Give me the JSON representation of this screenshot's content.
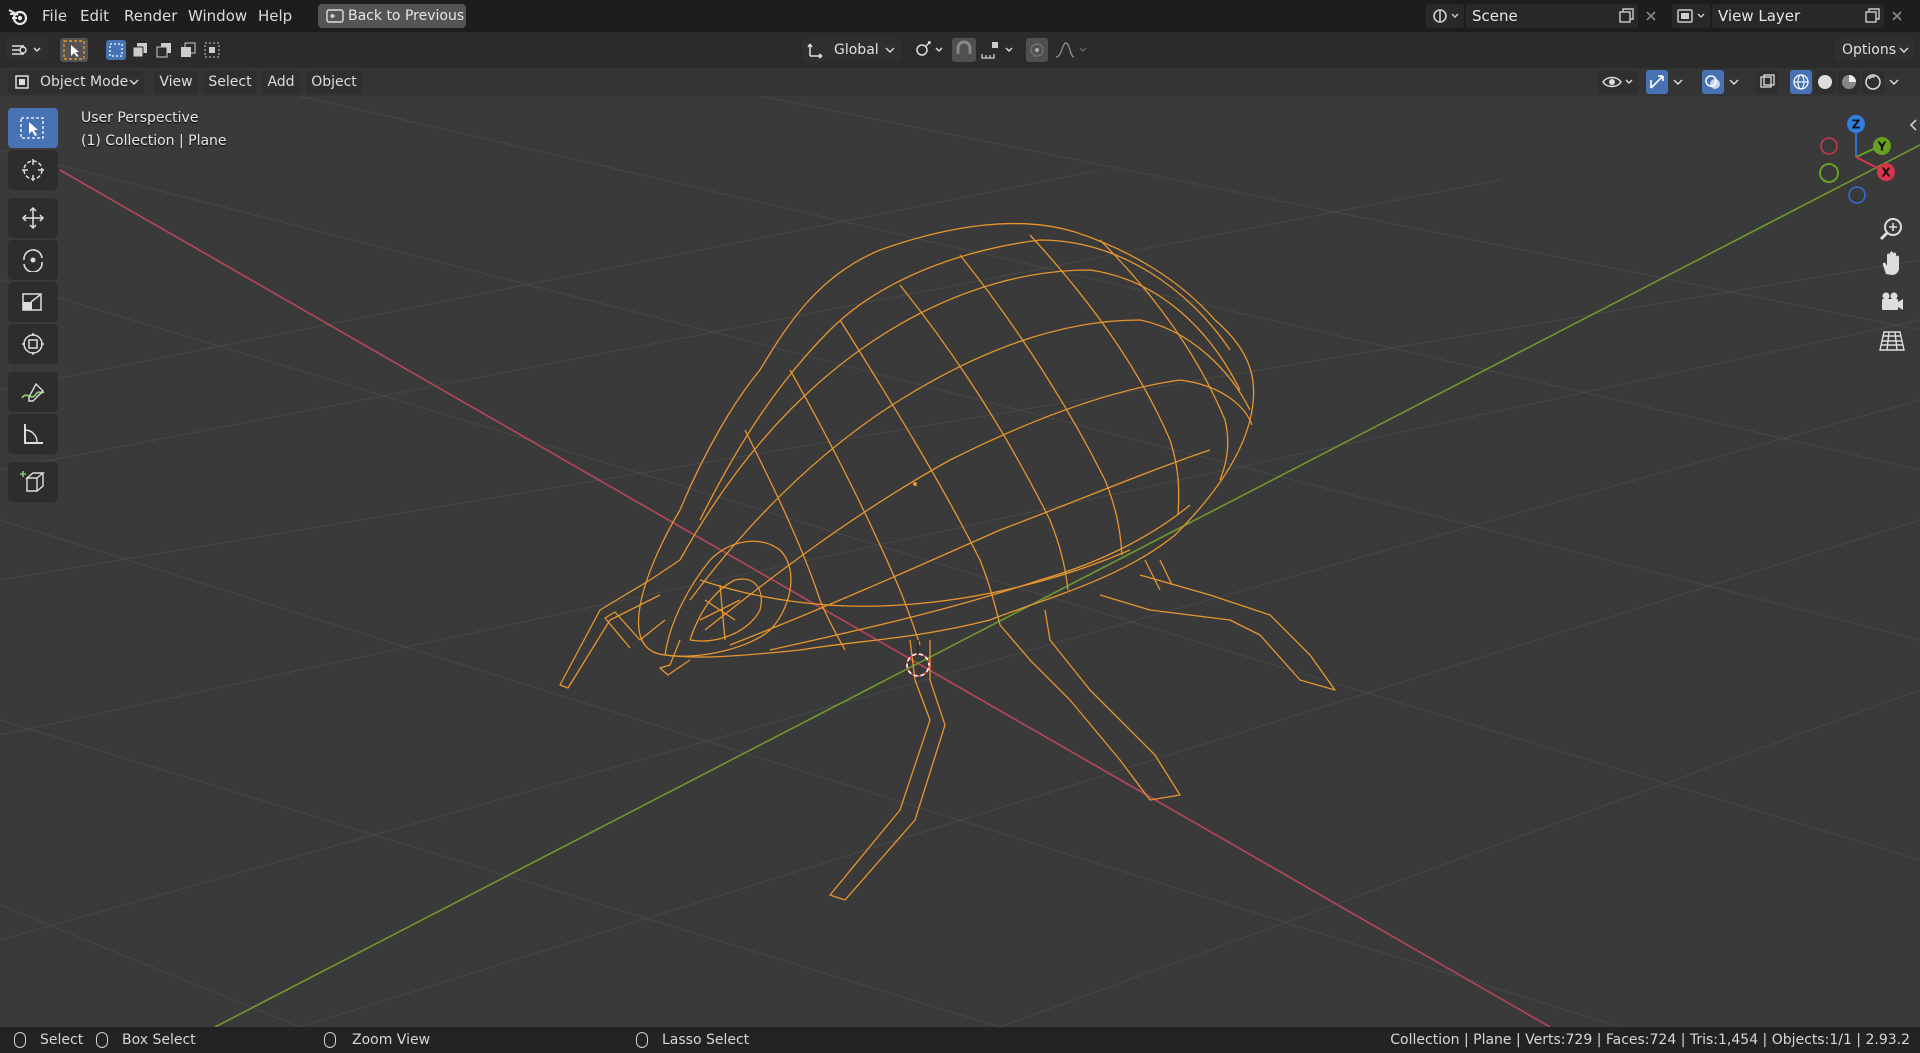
{
  "menu": {
    "file": "File",
    "edit": "Edit",
    "render": "Render",
    "window": "Window",
    "help": "Help"
  },
  "back_button": "Back to Previous",
  "scene": {
    "name": "Scene"
  },
  "view_layer": {
    "name": "View Layer"
  },
  "tool_header": {
    "orientation": "Global",
    "options": "Options"
  },
  "view_header": {
    "mode": "Object Mode",
    "view": "View",
    "select": "Select",
    "add": "Add",
    "object": "Object"
  },
  "viewport": {
    "perspective": "User Perspective",
    "collection_info": "(1) Collection | Plane",
    "wire_color": "#e7962e",
    "x_axis_color": "#b8465a",
    "y_axis_color": "#6e9a2d",
    "grid_color": "#4a4a4a"
  },
  "gizmo": {
    "z": "Z",
    "y": "Y",
    "x": "X"
  },
  "toolbar_icons": [
    "select-box-icon",
    "cursor-icon",
    "move-icon",
    "rotate-icon",
    "scale-icon",
    "transform-icon",
    "annotate-icon",
    "measure-icon",
    "add-cube-icon"
  ],
  "status": {
    "select": "Select",
    "box_select": "Box Select",
    "zoom_view": "Zoom View",
    "lasso_select": "Lasso Select",
    "stats": "Collection | Plane | Verts:729 | Faces:724 | Tris:1,454 | Objects:1/1 | 2.93.2"
  }
}
